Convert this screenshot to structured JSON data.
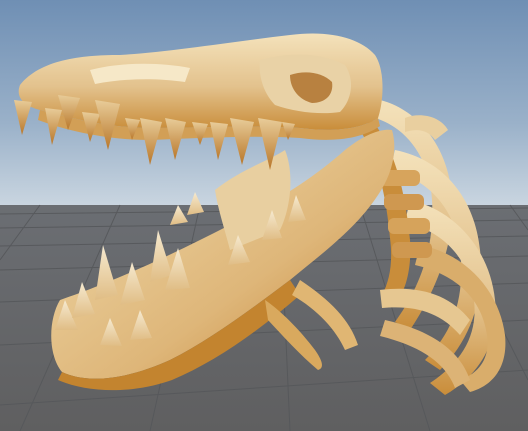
{
  "viewport": {
    "object": "skeleton-model",
    "colors": {
      "sky_top": "#6f8fb4",
      "sky_horizon": "#c9d5e0",
      "ground": "#616264",
      "grid_line": "#55575a",
      "bone_light": "#f3dfb4",
      "bone_mid": "#e2c08a",
      "bone_dark": "#c98d3a",
      "bone_shadow": "#b06d22"
    }
  }
}
